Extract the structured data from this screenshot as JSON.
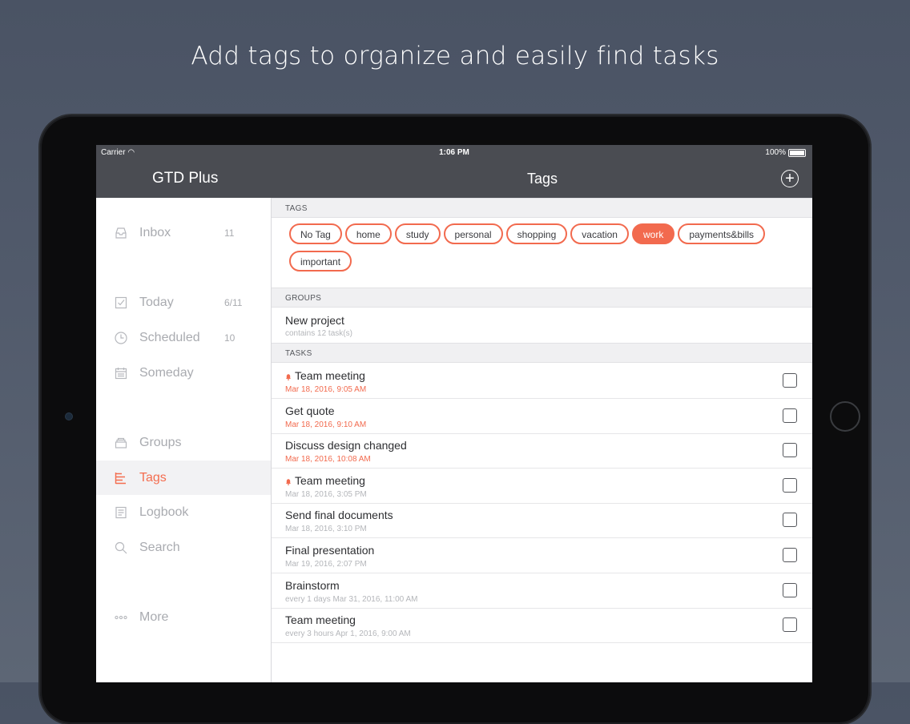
{
  "headline": "Add tags to organize and easily find tasks",
  "status": {
    "carrier": "Carrier",
    "time": "1:06 PM",
    "battery": "100%"
  },
  "app_title": "GTD Plus",
  "nav_title": "Tags",
  "add_label": "+",
  "sidebar": {
    "items": [
      {
        "label": "Inbox",
        "count": "11",
        "icon": "inbox-icon"
      },
      {
        "label": "Today",
        "count": "6/11",
        "icon": "check-calendar-icon"
      },
      {
        "label": "Scheduled",
        "count": "10",
        "icon": "clock-icon"
      },
      {
        "label": "Someday",
        "count": "",
        "icon": "calendar-icon"
      },
      {
        "label": "Groups",
        "count": "",
        "icon": "groups-icon"
      },
      {
        "label": "Tags",
        "count": "",
        "icon": "tags-icon",
        "active": true
      },
      {
        "label": "Logbook",
        "count": "",
        "icon": "logbook-icon"
      },
      {
        "label": "Search",
        "count": "",
        "icon": "search-icon"
      },
      {
        "label": "More",
        "count": "",
        "icon": "more-icon"
      }
    ]
  },
  "sections": {
    "tags": "TAGS",
    "groups": "GROUPS",
    "tasks": "TASKS"
  },
  "tags": [
    "No Tag",
    "home",
    "study",
    "personal",
    "shopping",
    "vacation",
    "work",
    "payments&bills",
    "important"
  ],
  "selected_tag": "work",
  "groups": [
    {
      "title": "New project",
      "sub": "contains 12 task(s)"
    }
  ],
  "tasks": [
    {
      "title": "Team meeting",
      "date": "Mar 18, 2016, 9:05 AM",
      "overdue": true,
      "alarm": true
    },
    {
      "title": "Get quote",
      "date": "Mar 18, 2016, 9:10 AM",
      "overdue": true,
      "alarm": false
    },
    {
      "title": "Discuss design changed",
      "date": "Mar 18, 2016, 10:08 AM",
      "overdue": true,
      "alarm": false
    },
    {
      "title": "Team meeting",
      "date": "Mar 18, 2016, 3:05 PM",
      "overdue": false,
      "alarm": true
    },
    {
      "title": "Send final documents",
      "date": "Mar 18, 2016, 3:10 PM",
      "overdue": false,
      "alarm": false
    },
    {
      "title": "Final presentation",
      "date": "Mar 19, 2016, 2:07 PM",
      "overdue": false,
      "alarm": false
    },
    {
      "title": "Brainstorm",
      "date": "every 1 days Mar 31, 2016, 11:00 AM",
      "overdue": false,
      "alarm": false
    },
    {
      "title": "Team meeting",
      "date": "every 3 hours Apr 1, 2016, 9:00 AM",
      "overdue": false,
      "alarm": false
    }
  ],
  "colors": {
    "accent": "#f26a4e",
    "navbar": "#4a4c52"
  }
}
